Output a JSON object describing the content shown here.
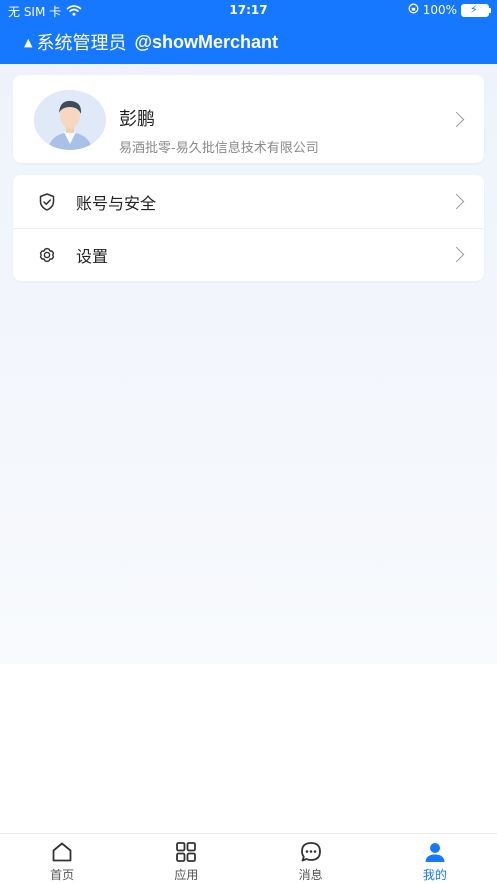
{
  "status_bar": {
    "carrier": "无 SIM 卡",
    "time": "17:17",
    "battery": "100%"
  },
  "header": {
    "role": "系统管理员",
    "merchant": "@showMerchant"
  },
  "profile": {
    "name": "彭鹏",
    "company": "易酒批零-易久批信息技术有限公司"
  },
  "menu": {
    "items": [
      {
        "label": "账号与安全",
        "icon": "shield-check-icon"
      },
      {
        "label": "设置",
        "icon": "gear-icon"
      }
    ]
  },
  "tabbar": {
    "tabs": [
      {
        "label": "首页",
        "icon": "home-icon"
      },
      {
        "label": "应用",
        "icon": "grid-icon"
      },
      {
        "label": "消息",
        "icon": "chat-icon"
      },
      {
        "label": "我的",
        "icon": "user-icon",
        "active": true
      }
    ]
  },
  "colors": {
    "brand": "#1677ff",
    "background": "#eef3fb"
  }
}
